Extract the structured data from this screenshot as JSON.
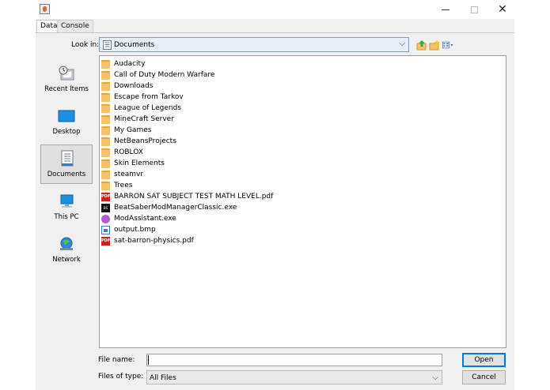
{
  "tabs": [
    {
      "label": "Data",
      "active": true
    },
    {
      "label": "Console",
      "active": false
    }
  ],
  "look_in": {
    "label": "Look in:",
    "value": "Documents"
  },
  "places": [
    {
      "label": "Recent Items",
      "icon": "recent-items-icon",
      "selected": false
    },
    {
      "label": "Desktop",
      "icon": "desktop-icon",
      "selected": false
    },
    {
      "label": "Documents",
      "icon": "documents-icon",
      "selected": true
    },
    {
      "label": "This PC",
      "icon": "this-pc-icon",
      "selected": false
    },
    {
      "label": "Network",
      "icon": "network-icon",
      "selected": false
    }
  ],
  "files": [
    {
      "name": "Audacity",
      "type": "folder"
    },
    {
      "name": "Call of Duty Modern Warfare",
      "type": "folder"
    },
    {
      "name": "Downloads",
      "type": "folder"
    },
    {
      "name": "Escape from Tarkov",
      "type": "folder"
    },
    {
      "name": "League of Legends",
      "type": "folder"
    },
    {
      "name": "MineCraft Server",
      "type": "folder"
    },
    {
      "name": "My Games",
      "type": "folder"
    },
    {
      "name": "NetBeansProjects",
      "type": "folder"
    },
    {
      "name": "ROBLOX",
      "type": "folder"
    },
    {
      "name": "Skin Elements",
      "type": "folder"
    },
    {
      "name": "steamvr",
      "type": "folder"
    },
    {
      "name": "Trees",
      "type": "folder"
    },
    {
      "name": "BARRON SAT SUBJECT TEST MATH LEVEL.pdf",
      "type": "pdf"
    },
    {
      "name": "BeatSaberModManagerClassic.exe",
      "type": "beat-exe"
    },
    {
      "name": "ModAssistant.exe",
      "type": "mod-exe"
    },
    {
      "name": "output.bmp",
      "type": "bmp"
    },
    {
      "name": "sat-barron-physics.pdf",
      "type": "pdf"
    }
  ],
  "file_name": {
    "label": "File name:",
    "value": ""
  },
  "file_type": {
    "label": "Files of type:",
    "value": "All Files"
  },
  "buttons": {
    "open": "Open",
    "cancel": "Cancel"
  },
  "colors": {
    "selection_border": "#0078d7",
    "folder": "#f5c26b",
    "pdf": "#c8241e"
  }
}
